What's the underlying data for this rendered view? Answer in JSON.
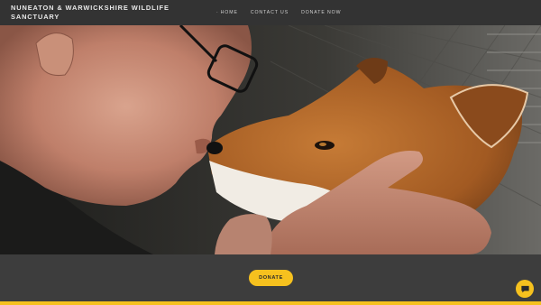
{
  "site": {
    "title": "NUNEATON & WARWICKSHIRE WILDLIFE SANCTUARY"
  },
  "nav": {
    "items": [
      "HOME",
      "CONTACT US",
      "DONATE NOW"
    ],
    "active_index": 0
  },
  "hero": {
    "image": "man kissing fox on nose"
  },
  "cta": {
    "donate_label": "DONATE"
  },
  "chat": {
    "icon": "chat-bubble-icon"
  },
  "colors": {
    "accent": "#f6c11e",
    "header_bg": "#333333",
    "band_bg": "#3d3d3d"
  }
}
